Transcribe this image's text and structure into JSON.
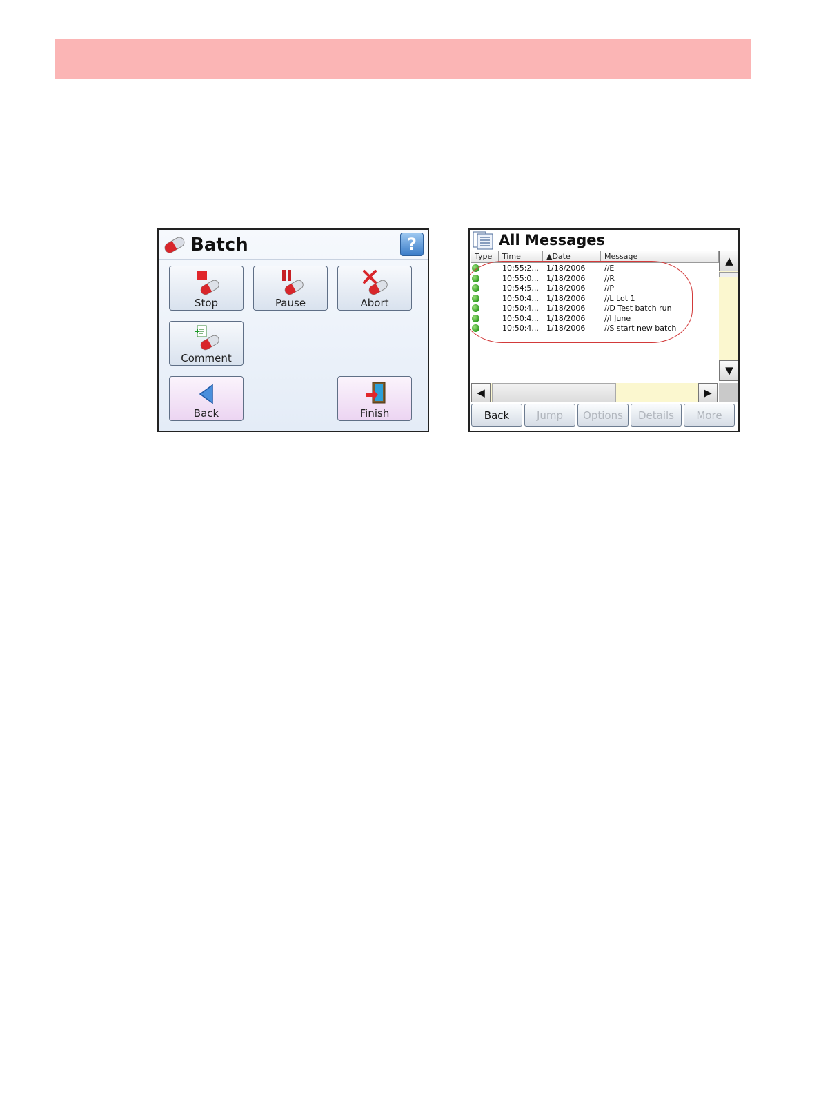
{
  "colors": {
    "header_band": "#fbb5b5",
    "status_ok": "#3a9d2c",
    "highlight_oval": "#d23a3a",
    "scroll_track": "#fbf7cf"
  },
  "batch_screen": {
    "title": "Batch",
    "help_label": "?",
    "buttons": {
      "stop": "Stop",
      "pause": "Pause",
      "abort": "Abort",
      "comment": "Comment",
      "back": "Back",
      "finish": "Finish"
    },
    "icons": [
      "batch-pill-icon",
      "help-icon",
      "stop-icon",
      "pause-icon",
      "abort-icon",
      "comment-icon",
      "back-arrow-icon",
      "finish-door-icon"
    ]
  },
  "messages_screen": {
    "title": "All Messages",
    "columns": {
      "type": "Type",
      "time": "Time",
      "date": "▲Date",
      "message": "Message"
    },
    "rows": [
      {
        "time": "10:55:2...",
        "date": "1/18/2006",
        "message": "//E"
      },
      {
        "time": "10:55:0...",
        "date": "1/18/2006",
        "message": "//R"
      },
      {
        "time": "10:54:5...",
        "date": "1/18/2006",
        "message": "//P"
      },
      {
        "time": "10:50:4...",
        "date": "1/18/2006",
        "message": "//L Lot 1"
      },
      {
        "time": "10:50:4...",
        "date": "1/18/2006",
        "message": "//D Test batch run"
      },
      {
        "time": "10:50:4...",
        "date": "1/18/2006",
        "message": "//I June"
      },
      {
        "time": "10:50:4...",
        "date": "1/18/2006",
        "message": "//S start new batch"
      }
    ],
    "scroll": {
      "up": "▲",
      "down": "▼",
      "left": "◀",
      "right": "▶"
    },
    "toolbar": {
      "back": "Back",
      "jump": "Jump",
      "options": "Options",
      "details": "Details",
      "more": "More"
    }
  }
}
